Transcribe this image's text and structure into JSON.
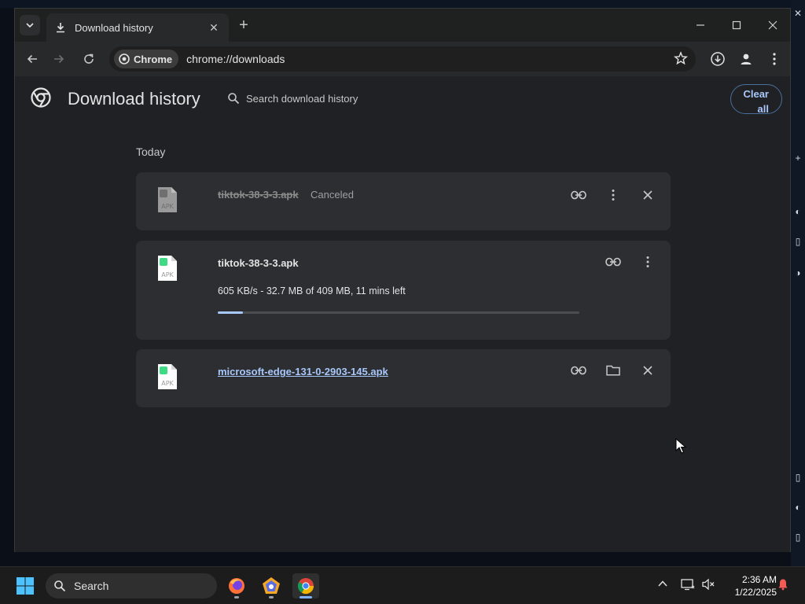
{
  "browser": {
    "tab": {
      "title": "Download history",
      "close": "✕"
    },
    "new_tab": "+",
    "omnibox": {
      "chip_label": "Chrome",
      "url": "chrome://downloads"
    }
  },
  "page": {
    "title": "Download history",
    "search_placeholder": "Search download history",
    "clear_all": "Clear all",
    "section": "Today"
  },
  "downloads": [
    {
      "filename": "tiktok-38-3-3.apk",
      "status": "Canceled",
      "state": "canceled",
      "icon_label": "APK"
    },
    {
      "filename": "tiktok-38-3-3.apk",
      "progress_text": "605 KB/s - 32.7 MB of 409 MB, 11 mins left",
      "progress": 0.07,
      "state": "in-progress",
      "icon_label": "APK"
    },
    {
      "filename": "microsoft-edge-131-0-2903-145.apk",
      "state": "complete",
      "icon_label": "APK"
    }
  ],
  "taskbar": {
    "search_label": "Search",
    "time": "2:36 AM",
    "date": "1/22/2025"
  },
  "colors": {
    "accent": "#a8c7fa",
    "page_bg": "#202124",
    "card_bg": "#2d2e31",
    "apk_green": "#3ddc84"
  }
}
